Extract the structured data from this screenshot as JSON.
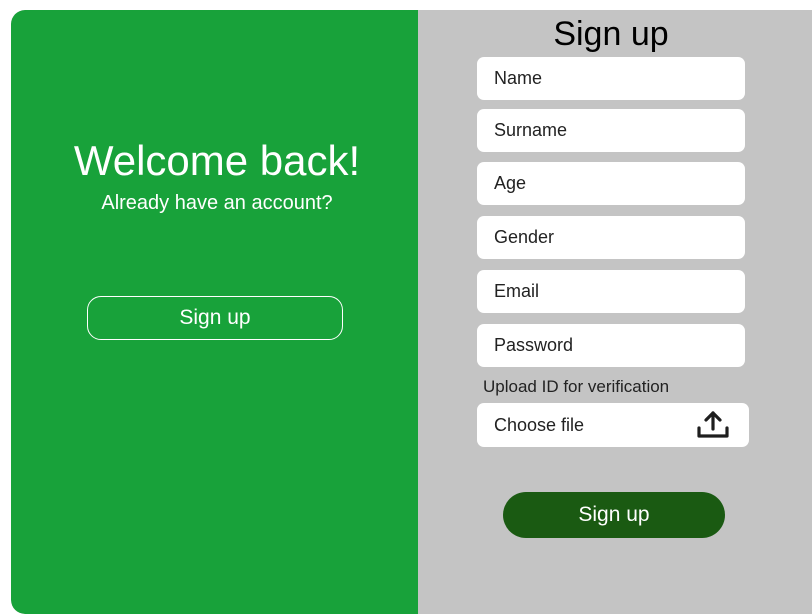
{
  "welcome": {
    "title": "Welcome back!",
    "subtitle": "Already have an account?",
    "button_label": "Sign up"
  },
  "form": {
    "title": "Sign up",
    "fields": [
      {
        "placeholder": "Name"
      },
      {
        "placeholder": "Surname"
      },
      {
        "placeholder": "Age"
      },
      {
        "placeholder": "Gender"
      },
      {
        "placeholder": "Email"
      },
      {
        "placeholder": "Password"
      }
    ],
    "upload_label": "Upload ID for verification",
    "file_placeholder": "Choose file",
    "file_icon": "upload-icon",
    "submit_label": "Sign up"
  },
  "colors": {
    "left_panel": "#18a23a",
    "right_panel": "#c4c4c4",
    "submit_button": "#1a5a12"
  }
}
